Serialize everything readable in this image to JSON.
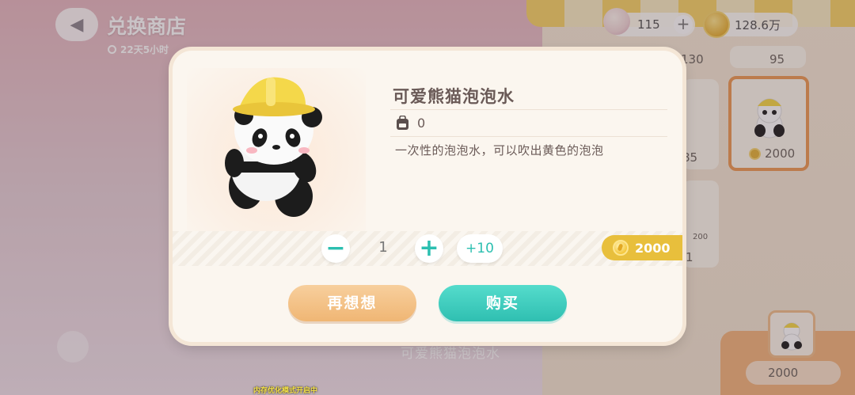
{
  "shop": {
    "title": "兑换商店",
    "timer": "22天5小时",
    "back_icon": "back-arrow-icon"
  },
  "currencies": {
    "gem": {
      "amount": "115",
      "icon": "cake-gem-icon"
    },
    "coin": {
      "amount": "128.6万",
      "icon": "coin-icon"
    }
  },
  "background_items": {
    "counts": [
      "130",
      "95"
    ],
    "selected_price": "2000",
    "partial_values": [
      "85",
      "200",
      "1"
    ],
    "selected_name": "可爱熊猫泡泡水",
    "bottom_price": "2000"
  },
  "modal": {
    "item_name": "可爱熊猫泡泡水",
    "owned_count": "0",
    "description": "一次性的泡泡水，可以吹出黄色的泡泡",
    "quantity": "1",
    "minus_label": "−",
    "plus_label": "+",
    "plus10_label": "+10",
    "total_price": "2000",
    "cancel_label": "再想想",
    "buy_label": "购买"
  },
  "debug": {
    "text": "内存优化模式开启中"
  },
  "colors": {
    "accent_teal": "#2fbfb1",
    "accent_orange": "#f0b674",
    "coin_gold": "#e8bf3c",
    "text_brown": "#6a5a57"
  }
}
